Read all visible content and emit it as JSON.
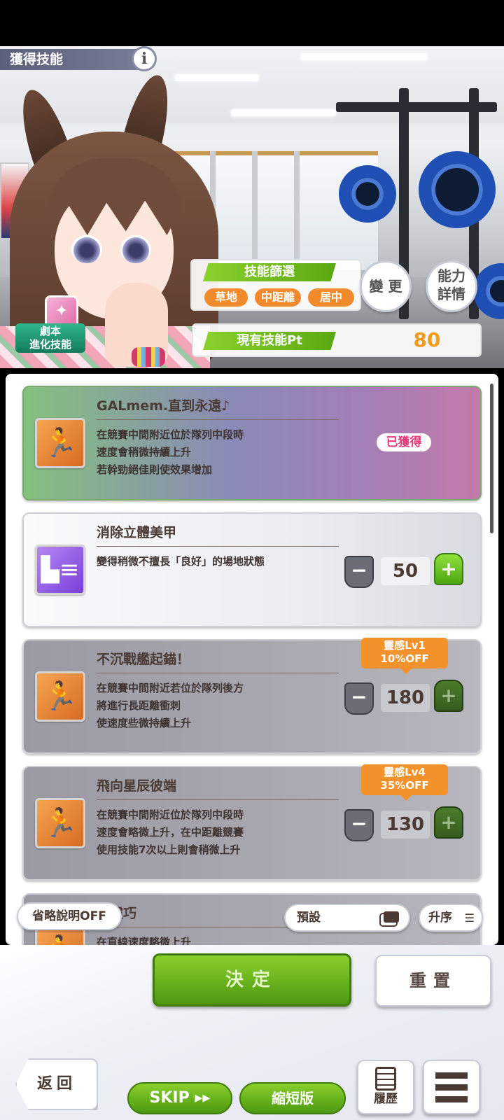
{
  "header": {
    "title": "獲得技能",
    "info_icon": "i",
    "scenario_badge": "劇本\n進化技能"
  },
  "filter": {
    "label": "技能篩選",
    "chips": [
      "草地",
      "中距離",
      "居中"
    ],
    "change_button": "變 更",
    "ability_button": "能力\n詳情"
  },
  "points": {
    "label": "現有技能Pt",
    "value": "80"
  },
  "skills": [
    {
      "name": "GALmem.直到永遠♪",
      "desc": "在競賽中間附近位於隊列中段時\n速度會稍微持續上升\n若幹勁絕佳則使效果增加",
      "status": "已獲得",
      "icon": "running-figure-icon"
    },
    {
      "name": "消除立體美甲",
      "desc": "變得稍微不擅長「良好」的場地狀態",
      "cost": "50",
      "icon": "shoe-debuff-icon"
    },
    {
      "name": "不沉戰艦起錨！",
      "desc": "在競賽中間附近若位於隊列後方\n將進行長距離衝刺\n使速度些微持續上升",
      "cost": "180",
      "hint": "靈感Lv1\n10%OFF",
      "icon": "running-figure-icon"
    },
    {
      "name": "飛向星辰彼端",
      "desc": "在競賽中間附近位於隊列中段時\n速度會略微上升，在中距離競賽\n使用技能7次以上則會稍微上升",
      "cost": "130",
      "hint": "靈感Lv4\n35%OFF",
      "icon": "running-figure-icon"
    },
    {
      "name": "線靈巧",
      "desc": "在直線速度略微上升",
      "icon": "running-figure-icon"
    }
  ],
  "controls": {
    "omit_desc": "省略說明OFF",
    "preset": "預設",
    "sort": "升序",
    "minus": "−",
    "plus": "+"
  },
  "actions": {
    "decide": "決定",
    "reset": "重置",
    "back": "返回",
    "skip": "SKIP ▸▸",
    "short": "縮短版",
    "history": "履歷"
  },
  "colors": {
    "accent_green": "#5aa812",
    "accent_orange": "#f08a2c",
    "acquired_pink": "#e6397a"
  }
}
